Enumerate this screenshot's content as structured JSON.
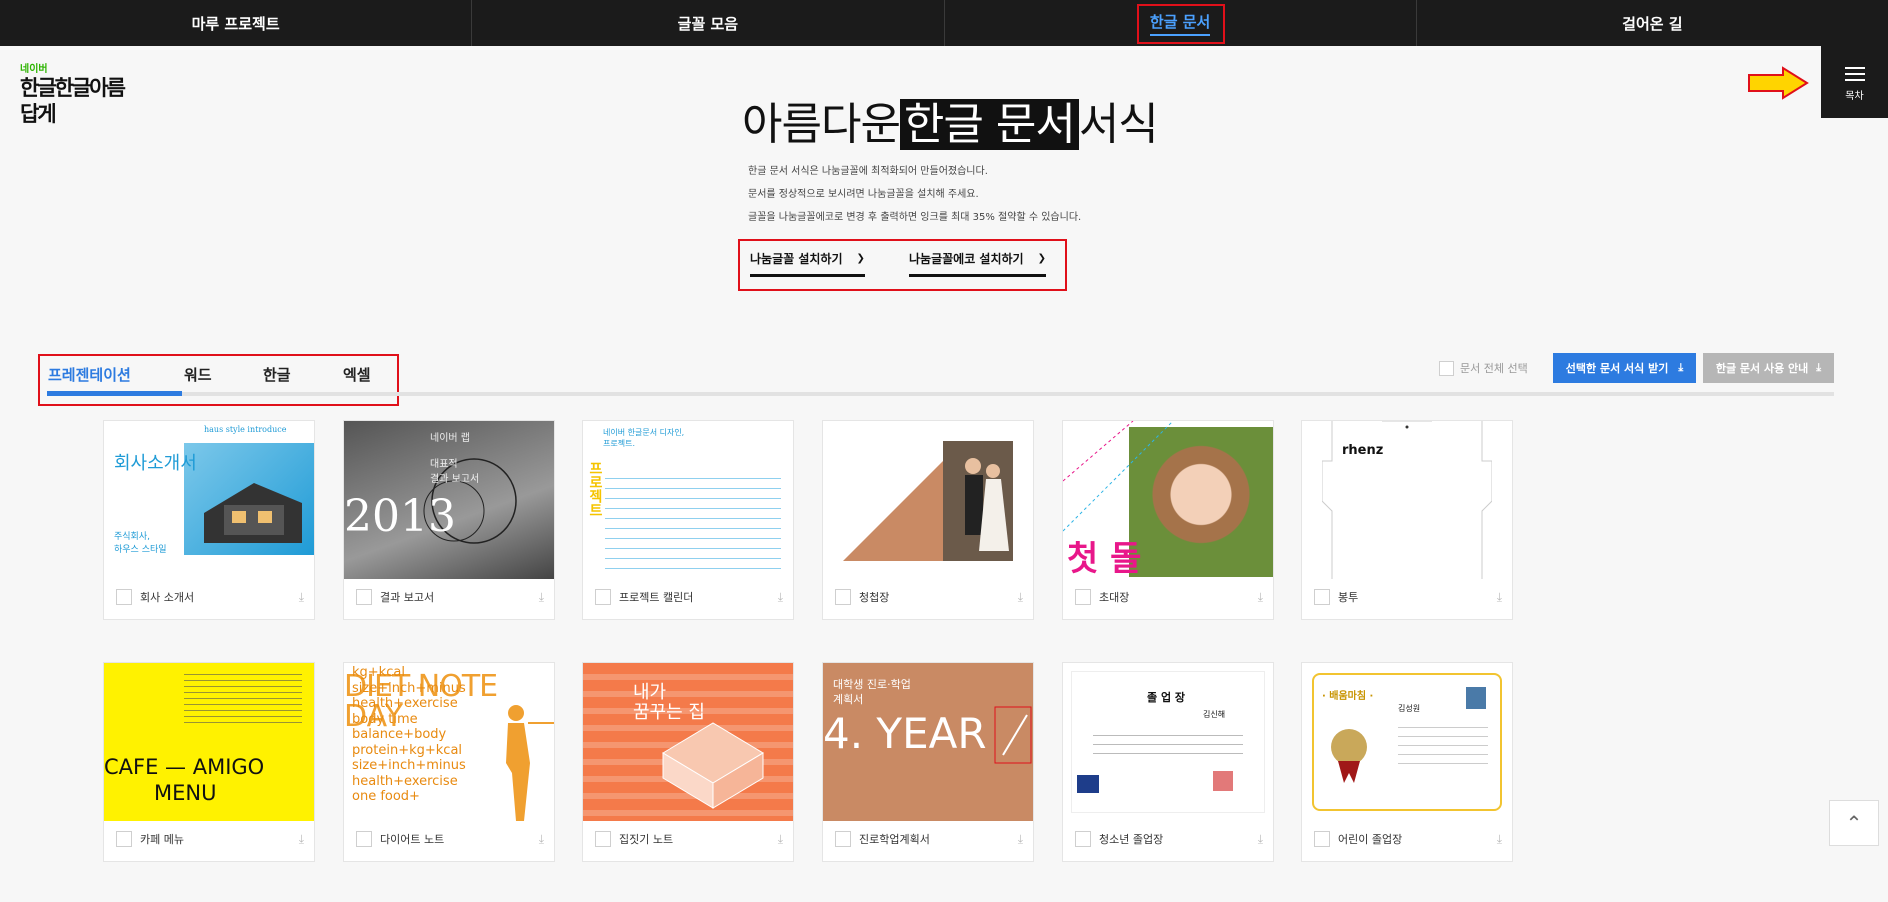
{
  "nav": {
    "items": [
      {
        "label": "마루 프로젝트"
      },
      {
        "label": "글꼴 모음"
      },
      {
        "label": "한글 문서"
      },
      {
        "label": "걸어온 길"
      }
    ]
  },
  "logo": {
    "naver": "네이버",
    "text": "한글한글아름답게"
  },
  "toc": {
    "label": "목차"
  },
  "hero": {
    "title_pre": "아름다운",
    "title_highlight": "한글 문서",
    "title_post": "서식",
    "desc": [
      "한글 문서 서식은 나눔글꼴에 최적화되어 만들어졌습니다.",
      "문서를 정상적으로 보시려면 나눔글꼴을 설치해 주세요.",
      "글꼴을 나눔글꼴에코로 변경 후 출력하면 잉크를 최대 35% 절약할 수 있습니다."
    ],
    "install_font": "나눔글꼴 설치하기",
    "install_eco": "나눔글꼴에코 설치하기"
  },
  "tabs": [
    {
      "label": "프레젠테이션"
    },
    {
      "label": "워드"
    },
    {
      "label": "한글"
    },
    {
      "label": "엑셀"
    }
  ],
  "controls": {
    "select_all": "문서 전체 선택",
    "download_selected": "선택한 문서 서식 받기",
    "usage_guide": "한글 문서 사용 안내"
  },
  "cards": [
    {
      "label": "회사 소개서",
      "thumb": {
        "title": "회사소개서",
        "sub": "haus style introduce",
        "body": "주식회사,\n하우스 스타일"
      }
    },
    {
      "label": "결과 보고서",
      "thumb": {
        "year": "2013",
        "head": "네이버 랩",
        "sub": "대표적\n결과 보고서"
      }
    },
    {
      "label": "프로젝트 캘린더",
      "thumb": {
        "head": "네이버 한글문서 디자인,\n프로젝트.",
        "vertical": "프로젝트"
      }
    },
    {
      "label": "청첩장",
      "thumb": {}
    },
    {
      "label": "초대장",
      "thumb": {
        "big": "첫 돌"
      }
    },
    {
      "label": "봉투",
      "thumb": {
        "brand": "rhenz"
      }
    },
    {
      "label": "카페 메뉴",
      "thumb": {
        "line1": "CAFE — AMIGO",
        "line2": "MENU"
      }
    },
    {
      "label": "다이어트 노트",
      "thumb": {
        "title1": "DIET NOTE",
        "title2": "DAY",
        "lines": [
          "kg+kcal",
          "size+inch+minus",
          "health+exercise",
          "body time",
          "balance+body",
          "protein+kg+kcal",
          "size+inch+minus",
          "health+exercise",
          "one food+"
        ]
      }
    },
    {
      "label": "집짓기 노트",
      "thumb": {
        "title": "내가\n꿈꾸는 집"
      }
    },
    {
      "label": "진로학업계획서",
      "thumb": {
        "head": "대학생 진로·학업\n계획서",
        "big": "4. YEAR"
      }
    },
    {
      "label": "청소년 졸업장",
      "thumb": {
        "title": "졸 업 장",
        "name": "김신해"
      }
    },
    {
      "label": "어린이 졸업장",
      "thumb": {
        "title": "· 배움마침 ·",
        "name": "김성원"
      }
    }
  ],
  "colors": {
    "accent": "#2d7be0",
    "annotation": "#e0101a",
    "nav_bg": "#1b1b1b"
  }
}
